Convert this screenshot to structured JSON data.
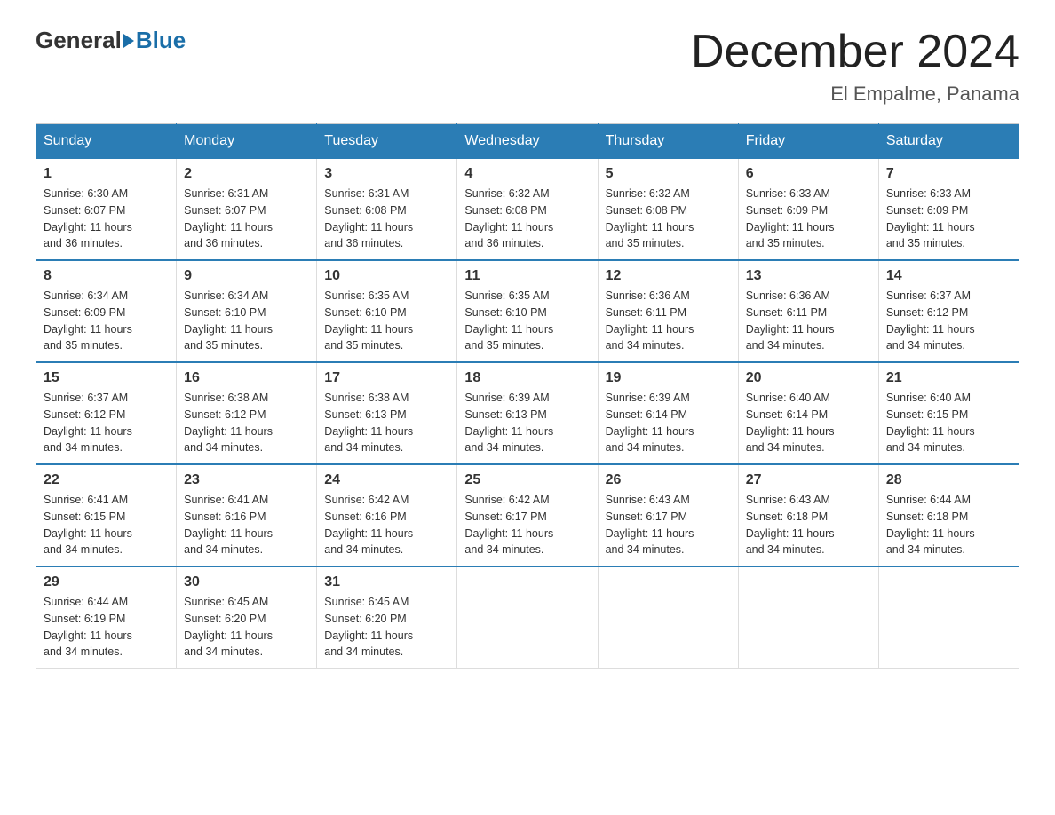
{
  "header": {
    "logo_general": "General",
    "logo_blue": "Blue",
    "main_title": "December 2024",
    "subtitle": "El Empalme, Panama"
  },
  "days_of_week": [
    "Sunday",
    "Monday",
    "Tuesday",
    "Wednesday",
    "Thursday",
    "Friday",
    "Saturday"
  ],
  "weeks": [
    [
      {
        "day": "1",
        "sunrise": "6:30 AM",
        "sunset": "6:07 PM",
        "daylight": "11 hours and 36 minutes."
      },
      {
        "day": "2",
        "sunrise": "6:31 AM",
        "sunset": "6:07 PM",
        "daylight": "11 hours and 36 minutes."
      },
      {
        "day": "3",
        "sunrise": "6:31 AM",
        "sunset": "6:08 PM",
        "daylight": "11 hours and 36 minutes."
      },
      {
        "day": "4",
        "sunrise": "6:32 AM",
        "sunset": "6:08 PM",
        "daylight": "11 hours and 36 minutes."
      },
      {
        "day": "5",
        "sunrise": "6:32 AM",
        "sunset": "6:08 PM",
        "daylight": "11 hours and 35 minutes."
      },
      {
        "day": "6",
        "sunrise": "6:33 AM",
        "sunset": "6:09 PM",
        "daylight": "11 hours and 35 minutes."
      },
      {
        "day": "7",
        "sunrise": "6:33 AM",
        "sunset": "6:09 PM",
        "daylight": "11 hours and 35 minutes."
      }
    ],
    [
      {
        "day": "8",
        "sunrise": "6:34 AM",
        "sunset": "6:09 PM",
        "daylight": "11 hours and 35 minutes."
      },
      {
        "day": "9",
        "sunrise": "6:34 AM",
        "sunset": "6:10 PM",
        "daylight": "11 hours and 35 minutes."
      },
      {
        "day": "10",
        "sunrise": "6:35 AM",
        "sunset": "6:10 PM",
        "daylight": "11 hours and 35 minutes."
      },
      {
        "day": "11",
        "sunrise": "6:35 AM",
        "sunset": "6:10 PM",
        "daylight": "11 hours and 35 minutes."
      },
      {
        "day": "12",
        "sunrise": "6:36 AM",
        "sunset": "6:11 PM",
        "daylight": "11 hours and 34 minutes."
      },
      {
        "day": "13",
        "sunrise": "6:36 AM",
        "sunset": "6:11 PM",
        "daylight": "11 hours and 34 minutes."
      },
      {
        "day": "14",
        "sunrise": "6:37 AM",
        "sunset": "6:12 PM",
        "daylight": "11 hours and 34 minutes."
      }
    ],
    [
      {
        "day": "15",
        "sunrise": "6:37 AM",
        "sunset": "6:12 PM",
        "daylight": "11 hours and 34 minutes."
      },
      {
        "day": "16",
        "sunrise": "6:38 AM",
        "sunset": "6:12 PM",
        "daylight": "11 hours and 34 minutes."
      },
      {
        "day": "17",
        "sunrise": "6:38 AM",
        "sunset": "6:13 PM",
        "daylight": "11 hours and 34 minutes."
      },
      {
        "day": "18",
        "sunrise": "6:39 AM",
        "sunset": "6:13 PM",
        "daylight": "11 hours and 34 minutes."
      },
      {
        "day": "19",
        "sunrise": "6:39 AM",
        "sunset": "6:14 PM",
        "daylight": "11 hours and 34 minutes."
      },
      {
        "day": "20",
        "sunrise": "6:40 AM",
        "sunset": "6:14 PM",
        "daylight": "11 hours and 34 minutes."
      },
      {
        "day": "21",
        "sunrise": "6:40 AM",
        "sunset": "6:15 PM",
        "daylight": "11 hours and 34 minutes."
      }
    ],
    [
      {
        "day": "22",
        "sunrise": "6:41 AM",
        "sunset": "6:15 PM",
        "daylight": "11 hours and 34 minutes."
      },
      {
        "day": "23",
        "sunrise": "6:41 AM",
        "sunset": "6:16 PM",
        "daylight": "11 hours and 34 minutes."
      },
      {
        "day": "24",
        "sunrise": "6:42 AM",
        "sunset": "6:16 PM",
        "daylight": "11 hours and 34 minutes."
      },
      {
        "day": "25",
        "sunrise": "6:42 AM",
        "sunset": "6:17 PM",
        "daylight": "11 hours and 34 minutes."
      },
      {
        "day": "26",
        "sunrise": "6:43 AM",
        "sunset": "6:17 PM",
        "daylight": "11 hours and 34 minutes."
      },
      {
        "day": "27",
        "sunrise": "6:43 AM",
        "sunset": "6:18 PM",
        "daylight": "11 hours and 34 minutes."
      },
      {
        "day": "28",
        "sunrise": "6:44 AM",
        "sunset": "6:18 PM",
        "daylight": "11 hours and 34 minutes."
      }
    ],
    [
      {
        "day": "29",
        "sunrise": "6:44 AM",
        "sunset": "6:19 PM",
        "daylight": "11 hours and 34 minutes."
      },
      {
        "day": "30",
        "sunrise": "6:45 AM",
        "sunset": "6:20 PM",
        "daylight": "11 hours and 34 minutes."
      },
      {
        "day": "31",
        "sunrise": "6:45 AM",
        "sunset": "6:20 PM",
        "daylight": "11 hours and 34 minutes."
      },
      null,
      null,
      null,
      null
    ]
  ],
  "labels": {
    "sunrise": "Sunrise:",
    "sunset": "Sunset:",
    "daylight": "Daylight:"
  }
}
